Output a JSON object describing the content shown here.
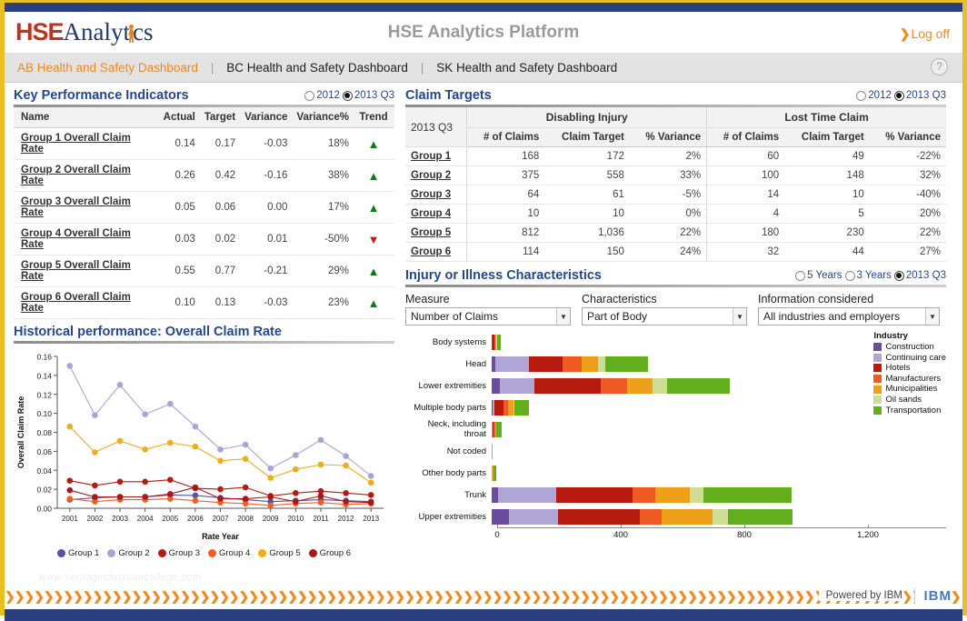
{
  "header": {
    "logo_hse": "HSE",
    "logo_analytics": "Analytics",
    "app_title": "HSE Analytics Platform",
    "logoff": "Log off",
    "logoff_chevron": "❯",
    "help_icon": "?"
  },
  "tabs": [
    {
      "label": "AB Health and Safety Dashboard",
      "active": true
    },
    {
      "label": "BC Health and Safety Dashboard",
      "active": false
    },
    {
      "label": "SK Health and Safety Dashboard",
      "active": false
    }
  ],
  "tab_separator": "|",
  "kpi": {
    "title": "Key Performance Indicators",
    "radios": [
      {
        "label": "2012",
        "selected": false
      },
      {
        "label": "2013 Q3",
        "selected": true
      }
    ],
    "columns": [
      "Name",
      "Actual",
      "Target",
      "Variance",
      "Variance%",
      "Trend"
    ],
    "rows": [
      {
        "name": "Group 1 Overall Claim Rate",
        "actual": "0.14",
        "target": "0.17",
        "variance": "-0.03",
        "variance_pct": "18%",
        "pct_state": "pos",
        "trend": "up"
      },
      {
        "name": "Group 2 Overall Claim Rate",
        "actual": "0.26",
        "target": "0.42",
        "variance": "-0.16",
        "variance_pct": "38%",
        "pct_state": "pos",
        "trend": "up"
      },
      {
        "name": "Group 3 Overall Claim Rate",
        "actual": "0.05",
        "target": "0.06",
        "variance": "0.00",
        "variance_pct": "17%",
        "pct_state": "pos",
        "trend": "up"
      },
      {
        "name": "Group 4 Overall Claim Rate",
        "actual": "0.03",
        "target": "0.02",
        "variance": "0.01",
        "variance_pct": "-50%",
        "pct_state": "neg",
        "trend": "down"
      },
      {
        "name": "Group 5 Overall Claim Rate",
        "actual": "0.55",
        "target": "0.77",
        "variance": "-0.21",
        "variance_pct": "29%",
        "pct_state": "pos",
        "trend": "up"
      },
      {
        "name": "Group 6 Overall Claim Rate",
        "actual": "0.10",
        "target": "0.13",
        "variance": "-0.03",
        "variance_pct": "23%",
        "pct_state": "pos",
        "trend": "up"
      }
    ]
  },
  "claim_targets": {
    "title": "Claim Targets",
    "radios": [
      {
        "label": "2012",
        "selected": false
      },
      {
        "label": "2013 Q3",
        "selected": true
      }
    ],
    "corner_label": "2013 Q3",
    "group_headers": [
      "Disabling Injury",
      "Lost Time Claim"
    ],
    "sub_headers": [
      "# of Claims",
      "Claim Target",
      "% Variance"
    ],
    "rows": [
      {
        "group": "Group 1",
        "di_claims": "168",
        "di_target": "172",
        "di_var": "2%",
        "di_state": "plain",
        "lt_claims": "60",
        "lt_target": "49",
        "lt_var": "-22%",
        "lt_state": "neg"
      },
      {
        "group": "Group 2",
        "di_claims": "375",
        "di_target": "558",
        "di_var": "33%",
        "di_state": "pos",
        "lt_claims": "100",
        "lt_target": "148",
        "lt_var": "32%",
        "lt_state": "pos"
      },
      {
        "group": "Group 3",
        "di_claims": "64",
        "di_target": "61",
        "di_var": "-5%",
        "di_state": "plain",
        "lt_claims": "14",
        "lt_target": "10",
        "lt_var": "-40%",
        "lt_state": "neg"
      },
      {
        "group": "Group 4",
        "di_claims": "10",
        "di_target": "10",
        "di_var": "0%",
        "di_state": "plain",
        "lt_claims": "4",
        "lt_target": "5",
        "lt_var": "20%",
        "lt_state": "pos"
      },
      {
        "group": "Group 5",
        "di_claims": "812",
        "di_target": "1,036",
        "di_var": "22%",
        "di_state": "pos",
        "lt_claims": "180",
        "lt_target": "230",
        "lt_var": "22%",
        "lt_state": "pos"
      },
      {
        "group": "Group 6",
        "di_claims": "114",
        "di_target": "150",
        "di_var": "24%",
        "di_state": "pos",
        "lt_claims": "32",
        "lt_target": "44",
        "lt_var": "27%",
        "lt_state": "pos"
      }
    ]
  },
  "historical": {
    "title": "Historical performance: Overall Claim Rate"
  },
  "injury": {
    "title": "Injury or Illness Characteristics",
    "radios": [
      {
        "label": "5 Years",
        "selected": false
      },
      {
        "label": "3 Years",
        "selected": false
      },
      {
        "label": "2013 Q3",
        "selected": true
      }
    ],
    "selects": [
      {
        "label": "Measure",
        "value": "Number of Claims"
      },
      {
        "label": "Characteristics",
        "value": "Part of Body"
      },
      {
        "label": "Information considered",
        "value": "All industries and employers"
      }
    ],
    "legend_title": "Industry"
  },
  "footer": {
    "watermark": "www.heritagechristiancollege.com",
    "powered_by": "Powered by IBM",
    "ibm": "IBM"
  },
  "chart_data": [
    {
      "type": "line",
      "title": "Historical performance: Overall Claim Rate",
      "xlabel": "Rate Year",
      "ylabel": "Overall Claim Rate",
      "x": [
        2001,
        2002,
        2003,
        2004,
        2005,
        2006,
        2007,
        2008,
        2009,
        2010,
        2011,
        2012,
        2013
      ],
      "ylim": [
        0,
        0.16
      ],
      "yticks": [
        "0.00",
        "0.02",
        "0.04",
        "0.06",
        "0.08",
        "0.10",
        "0.12",
        "0.14",
        "0.16"
      ],
      "grid": false,
      "legend_position": "bottom",
      "series": [
        {
          "name": "Group 1",
          "color": "#5b4ea5",
          "values": [
            0.009,
            0.011,
            0.012,
            0.012,
            0.014,
            0.0135,
            0.011,
            0.009,
            0.007,
            0.008,
            0.009,
            0.008,
            0.007
          ]
        },
        {
          "name": "Group 2",
          "color": "#aaa3d8",
          "values": [
            0.15,
            0.098,
            0.13,
            0.099,
            0.11,
            0.086,
            0.062,
            0.067,
            0.042,
            0.056,
            0.072,
            0.055,
            0.034
          ]
        },
        {
          "name": "Group 3",
          "color": "#b51b0e",
          "values": [
            0.029,
            0.024,
            0.028,
            0.028,
            0.03,
            0.021,
            0.02,
            0.022,
            0.013,
            0.016,
            0.018,
            0.016,
            0.014
          ]
        },
        {
          "name": "Group 4",
          "color": "#ef6024",
          "values": [
            0.01,
            0.007,
            0.009,
            0.009,
            0.01,
            0.008,
            0.006,
            0.005,
            0.003,
            0.005,
            0.006,
            0.004,
            0.005
          ]
        },
        {
          "name": "Group 5",
          "color": "#efac1b",
          "values": [
            0.086,
            0.059,
            0.071,
            0.062,
            0.069,
            0.065,
            0.05,
            0.052,
            0.032,
            0.041,
            0.046,
            0.045,
            0.027
          ]
        },
        {
          "name": "Group 6",
          "color": "#a8181b",
          "values": [
            0.019,
            0.012,
            0.012,
            0.012,
            0.015,
            0.022,
            0.01,
            0.01,
            0.012,
            0.007,
            0.013,
            0.007,
            0.006
          ]
        }
      ]
    },
    {
      "type": "bar",
      "orientation": "horizontal",
      "stacked": true,
      "title": "Injury or Illness Characteristics",
      "xlabel": "",
      "ylabel": "",
      "xlim": [
        0,
        1200
      ],
      "xticks": [
        "0",
        "400",
        "800",
        "1,200"
      ],
      "categories": [
        "Body systems",
        "Head",
        "Lower extremities",
        "Multiple body parts",
        "Neck, including throat",
        "Not coded",
        "Other body parts",
        "Trunk",
        "Upper extremities"
      ],
      "legend_position": "right",
      "series": [
        {
          "name": "Construction",
          "color": "#6b4ca0",
          "values": [
            2,
            13,
            25,
            4,
            1,
            0,
            1,
            20,
            55
          ]
        },
        {
          "name": "Continuing care",
          "color": "#b0a6d6",
          "values": [
            2,
            107,
            112,
            4,
            2,
            0,
            1,
            190,
            160
          ]
        },
        {
          "name": "Hotels",
          "color": "#b51b0e",
          "values": [
            4,
            110,
            215,
            30,
            4,
            0,
            1,
            245,
            265
          ]
        },
        {
          "name": "Manufacturers",
          "color": "#ef5a24",
          "values": [
            5,
            60,
            85,
            16,
            5,
            0,
            1,
            75,
            70
          ]
        },
        {
          "name": "Municipalities",
          "color": "#efa01b",
          "values": [
            3,
            55,
            85,
            18,
            3,
            2,
            1,
            110,
            165
          ]
        },
        {
          "name": "Oil sands",
          "color": "#cfdd94",
          "values": [
            1,
            22,
            45,
            2,
            1,
            0,
            1,
            45,
            50
          ]
        },
        {
          "name": "Transportation",
          "color": "#63ae1c",
          "values": [
            12,
            140,
            205,
            46,
            16,
            0,
            10,
            285,
            210
          ]
        }
      ]
    }
  ]
}
